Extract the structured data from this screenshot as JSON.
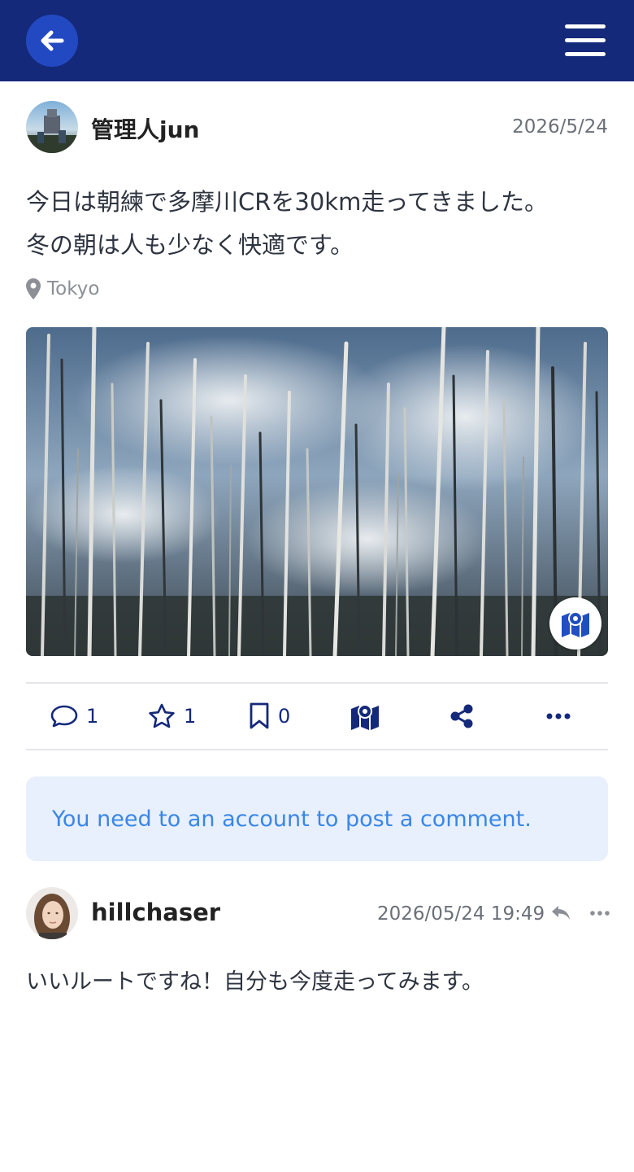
{
  "colors": {
    "header_bg": "#14297a",
    "back_button_bg": "#2349c2",
    "accent": "#14297a",
    "notice_bg": "#e8f0fd",
    "notice_text": "#3a86e6"
  },
  "header": {
    "back_icon": "arrow-left-icon",
    "menu_icon": "hamburger-menu-icon"
  },
  "post": {
    "author": "管理人jun",
    "date": "2026/5/24",
    "body_line1": "今日は朝練で多摩川CRを30km走ってきました。",
    "body_line2": "冬の朝は人も少なく快適です。",
    "location": "Tokyo",
    "location_icon": "map-marker-icon",
    "image_map_icon": "map-icon"
  },
  "actions": {
    "comments": {
      "icon": "comment-icon",
      "count": "1"
    },
    "favorites": {
      "icon": "star-icon",
      "count": "1"
    },
    "bookmarks": {
      "icon": "bookmark-icon",
      "count": "0"
    },
    "map": {
      "icon": "map-icon"
    },
    "share": {
      "icon": "share-icon"
    },
    "more": {
      "icon": "ellipsis-icon"
    }
  },
  "login_notice": "You need to an account to post a comment.",
  "comments": [
    {
      "author": "hillchaser",
      "date": "2026/05/24 19:49",
      "body": "いいルートですね！自分も今度走ってみます。",
      "reply_icon": "reply-icon",
      "more_icon": "ellipsis-icon"
    }
  ]
}
